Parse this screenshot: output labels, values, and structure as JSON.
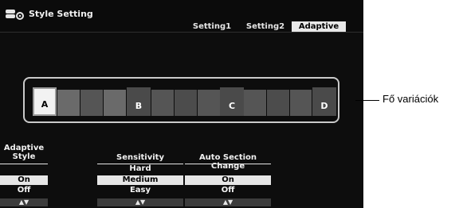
{
  "window": {
    "title": "Style Setting",
    "title_icon": "style-setting-icon"
  },
  "tabs": [
    {
      "label": "Setting1",
      "active": false
    },
    {
      "label": "Setting2",
      "active": false
    },
    {
      "label": "Adaptive",
      "active": true
    }
  ],
  "variations": {
    "items": [
      {
        "label": "A",
        "selected": true
      },
      {
        "label": "B",
        "selected": false
      },
      {
        "label": "C",
        "selected": false
      },
      {
        "label": "D",
        "selected": false
      }
    ]
  },
  "adaptive_style": {
    "label_line1": "Adaptive",
    "label_line2": "Style",
    "options": [
      "On",
      "Off"
    ],
    "selected": "On",
    "arrows": "▲▼"
  },
  "sensitivity": {
    "label": "Sensitivity",
    "options": [
      "Hard",
      "Medium",
      "Easy"
    ],
    "selected": "Medium",
    "arrows": "▲▼"
  },
  "auto_section_change": {
    "label": "Auto Section Change",
    "options": [
      "On",
      "Off"
    ],
    "selected": "On",
    "arrows": "▲▼"
  },
  "annotation": {
    "text": "Fő variációk"
  },
  "colors": {
    "screen_bg": "#0d0d0d",
    "selected_bg": "#e6e6e6",
    "segment_gray": "#555555"
  }
}
